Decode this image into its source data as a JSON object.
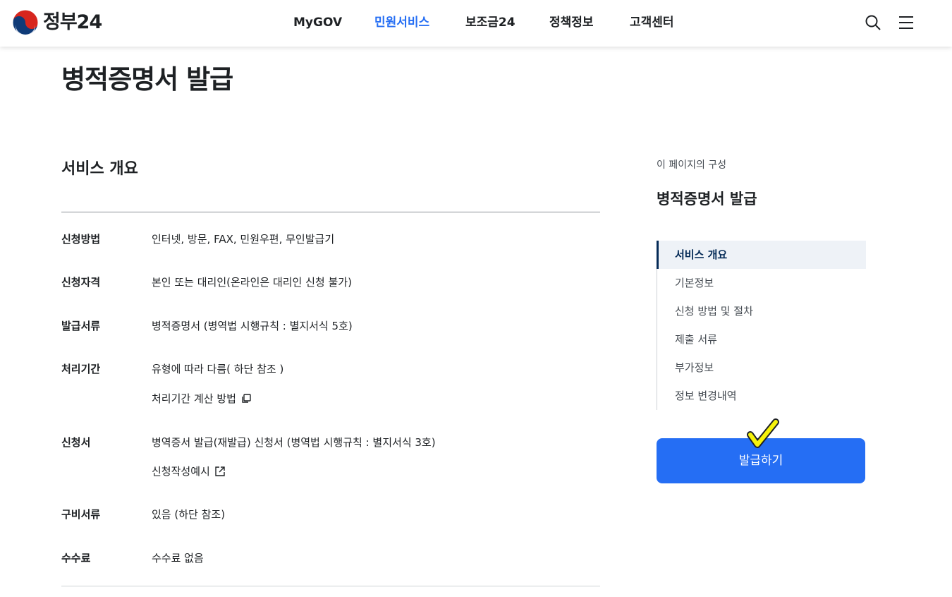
{
  "header": {
    "logo_text": "정부24",
    "nav": [
      {
        "label": "MyGOV",
        "active": false
      },
      {
        "label": "민원서비스",
        "active": true
      },
      {
        "label": "보조금24",
        "active": false
      },
      {
        "label": "정책정보",
        "active": false
      },
      {
        "label": "고객센터",
        "active": false
      }
    ],
    "icons": [
      "search-icon",
      "menu-icon"
    ]
  },
  "page": {
    "title": "병적증명서 발급"
  },
  "overview": {
    "title": "서비스 개요",
    "rows": [
      {
        "label": "신청방법",
        "value": "인터넷, 방문, FAX, 민원우편, 무인발급기"
      },
      {
        "label": "신청자격",
        "value": "본인 또는 대리인(온라인은 대리인 신청 불가)"
      },
      {
        "label": "발급서류",
        "value": "병적증명서 (병역법 시행규칙 : 별지서식 5호)"
      },
      {
        "label": "처리기간",
        "value": "유형에 따라 다름( 하단 참조 )",
        "link": "처리기간 계산 방법"
      },
      {
        "label": "신청서",
        "value": "병역증서 발급(재발급) 신청서 (병역법 시행규칙 : 별지서식 3호)",
        "link": "신청작성예시"
      },
      {
        "label": "구비서류",
        "value": "있음 (하단 참조)"
      },
      {
        "label": "수수료",
        "value": "수수료 없음"
      }
    ]
  },
  "toc": {
    "caption": "이 페이지의 구성",
    "title": "병적증명서 발급",
    "items": [
      {
        "label": "서비스 개요",
        "active": true
      },
      {
        "label": "기본정보",
        "active": false
      },
      {
        "label": "신청 방법 및 절차",
        "active": false
      },
      {
        "label": "제출 서류",
        "active": false
      },
      {
        "label": "부가정보",
        "active": false
      },
      {
        "label": "정보 변경내역",
        "active": false
      }
    ]
  },
  "actions": {
    "issue_label": "발급하기"
  },
  "colors": {
    "primary": "#256ef4",
    "toc_active_bg": "#eef2f7",
    "toc_active_text": "#052b57",
    "check_mark": "#f5f20a"
  }
}
